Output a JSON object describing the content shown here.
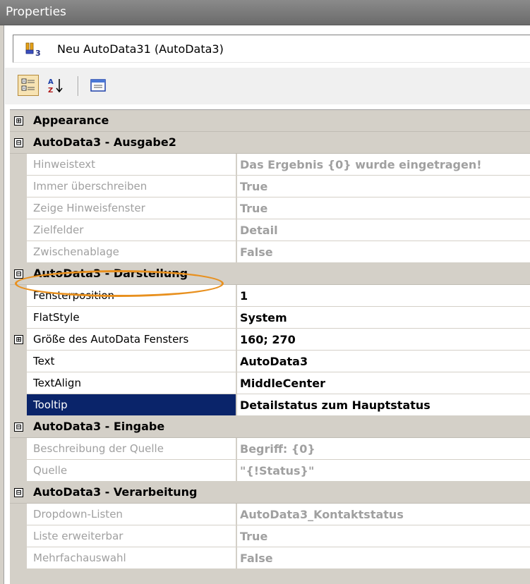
{
  "window": {
    "title": "Properties"
  },
  "selector": {
    "label": "Neu AutoData31 (AutoData3)"
  },
  "toolbar": {
    "buttons": [
      {
        "icon": "categorized-icon",
        "active": true
      },
      {
        "icon": "sort-alphabetical-icon",
        "active": false
      },
      {
        "icon": "property-pages-icon",
        "active": false
      }
    ]
  },
  "colors": {
    "selection": "#0a246a",
    "highlight_ring": "#e8901e",
    "disabled_text": "#a0a0a0",
    "category_bg": "#d4d0c8"
  },
  "grid": {
    "categories": [
      {
        "label": "Appearance",
        "expander": "⊞",
        "expanded": false,
        "properties": []
      },
      {
        "label": "AutoData3 - Ausgabe2",
        "expander": "⊟",
        "expanded": true,
        "properties": [
          {
            "name": "Hinweistext",
            "value": "Das Ergebnis {0} wurde eingetragen!",
            "readonly": true
          },
          {
            "name": "Immer überschreiben",
            "value": "True",
            "readonly": true
          },
          {
            "name": "Zeige Hinweisfenster",
            "value": "True",
            "readonly": true
          },
          {
            "name": "Zielfelder",
            "value": "Detail",
            "readonly": true
          },
          {
            "name": "Zwischenablage",
            "value": "False",
            "readonly": true
          }
        ]
      },
      {
        "label": "AutoData3 - Darstellung",
        "expander": "⊟",
        "expanded": true,
        "highlighted": true,
        "properties": [
          {
            "name": "Fensterposition",
            "value": "1",
            "readonly": false
          },
          {
            "name": "FlatStyle",
            "value": "System",
            "readonly": false
          },
          {
            "name": "Größe des AutoData Fensters",
            "value": "160; 270",
            "readonly": false,
            "expander": "⊞"
          },
          {
            "name": "Text",
            "value": "AutoData3",
            "readonly": false
          },
          {
            "name": "TextAlign",
            "value": "MiddleCenter",
            "readonly": false
          },
          {
            "name": "Tooltip",
            "value": "Detailstatus zum Hauptstatus",
            "readonly": false,
            "selected": true
          }
        ]
      },
      {
        "label": "AutoData3 - Eingabe",
        "expander": "⊟",
        "expanded": true,
        "properties": [
          {
            "name": "Beschreibung der Quelle",
            "value": "Begriff: {0}",
            "readonly": true
          },
          {
            "name": "Quelle",
            "value": "\"{!Status}\"",
            "readonly": true
          }
        ]
      },
      {
        "label": "AutoData3 - Verarbeitung",
        "expander": "⊟",
        "expanded": true,
        "properties": [
          {
            "name": "Dropdown-Listen",
            "value": "AutoData3_Kontaktstatus",
            "readonly": true
          },
          {
            "name": "Liste erweiterbar",
            "value": "True",
            "readonly": true
          },
          {
            "name": "Mehrfachauswahl",
            "value": "False",
            "readonly": true
          }
        ]
      }
    ]
  }
}
